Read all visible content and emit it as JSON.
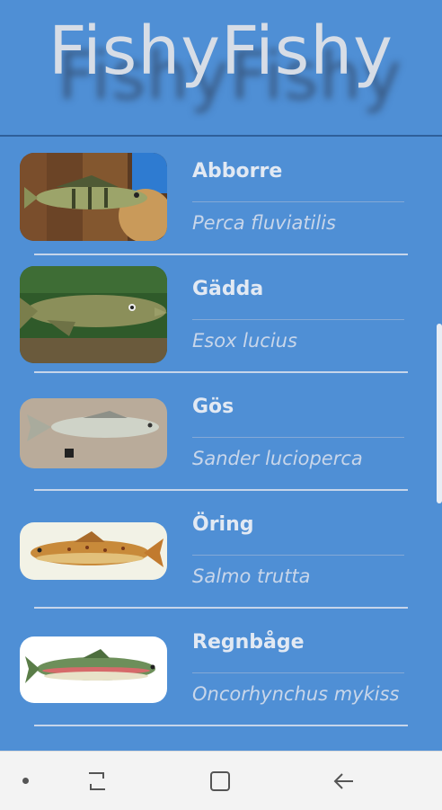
{
  "app": {
    "title": "FishyFishy"
  },
  "fish": [
    {
      "name": "Abborre",
      "scientific": "Perca fluviatilis",
      "image": "perch-image"
    },
    {
      "name": "Gädda",
      "scientific": "Esox lucius",
      "image": "pike-image"
    },
    {
      "name": "Gös",
      "scientific": "Sander lucioperca",
      "image": "zander-image"
    },
    {
      "name": "Öring",
      "scientific": "Salmo trutta",
      "image": "trout-image"
    },
    {
      "name": "Regnbåge",
      "scientific": "Oncorhynchus mykiss",
      "image": "rainbow-trout-image"
    }
  ],
  "navbar": {
    "icons": [
      "dot-icon",
      "recent-apps-icon",
      "home-icon",
      "back-icon"
    ]
  },
  "colors": {
    "background": "#4f8fd5",
    "navbar": "#f3f3f3"
  }
}
